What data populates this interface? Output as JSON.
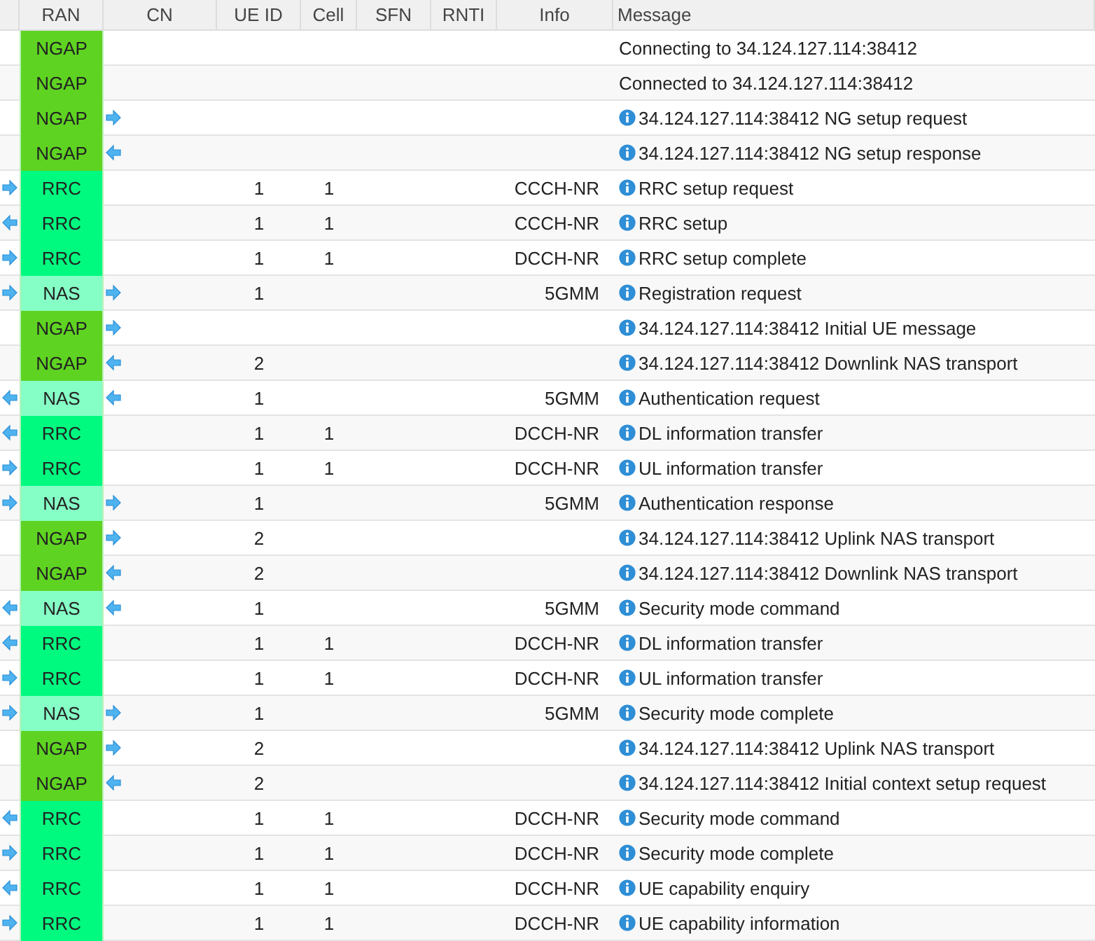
{
  "columns": [
    "",
    "RAN",
    "CN",
    "UE ID",
    "Cell",
    "SFN",
    "RNTI",
    "Info",
    "Message"
  ],
  "rows": [
    {
      "protocol": "NGAP",
      "kind": "ngap",
      "ue_id": "",
      "cell": "",
      "info": "",
      "info_icon": false,
      "message": "Connecting to 34.124.127.114:38412"
    },
    {
      "protocol": "NGAP",
      "kind": "ngap",
      "ue_id": "",
      "cell": "",
      "info": "",
      "info_icon": false,
      "message": "Connected to 34.124.127.114:38412"
    },
    {
      "protocol": "NGAP",
      "kind": "ngap",
      "cn_arrow": {
        "kind": "right"
      },
      "ue_id": "",
      "cell": "",
      "info": "",
      "info_icon": true,
      "message": "34.124.127.114:38412 NG setup request"
    },
    {
      "protocol": "NGAP",
      "kind": "ngap",
      "cn_arrow": {
        "kind": "left"
      },
      "ue_id": "",
      "cell": "",
      "info": "",
      "info_icon": true,
      "message": "34.124.127.114:38412 NG setup response"
    },
    {
      "ran_arrow": {
        "kind": "right"
      },
      "protocol": "RRC",
      "kind": "rrc",
      "ue_id": "1",
      "cell": "1",
      "info": "CCCH-NR",
      "info_icon": true,
      "message": "RRC setup request"
    },
    {
      "ran_arrow": {
        "kind": "left"
      },
      "protocol": "RRC",
      "kind": "rrc",
      "ue_id": "1",
      "cell": "1",
      "info": "CCCH-NR",
      "info_icon": true,
      "message": "RRC setup"
    },
    {
      "ran_arrow": {
        "kind": "right"
      },
      "protocol": "RRC",
      "kind": "rrc",
      "ue_id": "1",
      "cell": "1",
      "info": "DCCH-NR",
      "info_icon": true,
      "message": "RRC setup complete"
    },
    {
      "ran_arrow": {
        "kind": "right"
      },
      "protocol": "NAS",
      "kind": "nas",
      "cn_arrow": {
        "kind": "right"
      },
      "ue_id": "1",
      "cell": "",
      "info": "5GMM",
      "info_icon": true,
      "message": "Registration request"
    },
    {
      "protocol": "NGAP",
      "kind": "ngap",
      "cn_arrow": {
        "kind": "right"
      },
      "ue_id": "",
      "cell": "",
      "info": "",
      "info_icon": true,
      "message": "34.124.127.114:38412 Initial UE message"
    },
    {
      "protocol": "NGAP",
      "kind": "ngap",
      "cn_arrow": {
        "kind": "left"
      },
      "ue_id": "2",
      "cell": "",
      "info": "",
      "info_icon": true,
      "message": "34.124.127.114:38412 Downlink NAS transport"
    },
    {
      "ran_arrow": {
        "kind": "left"
      },
      "protocol": "NAS",
      "kind": "nas",
      "cn_arrow": {
        "kind": "left"
      },
      "ue_id": "1",
      "cell": "",
      "info": "5GMM",
      "info_icon": true,
      "message": "Authentication request"
    },
    {
      "ran_arrow": {
        "kind": "left"
      },
      "protocol": "RRC",
      "kind": "rrc",
      "ue_id": "1",
      "cell": "1",
      "info": "DCCH-NR",
      "info_icon": true,
      "message": "DL information transfer"
    },
    {
      "ran_arrow": {
        "kind": "right"
      },
      "protocol": "RRC",
      "kind": "rrc",
      "ue_id": "1",
      "cell": "1",
      "info": "DCCH-NR",
      "info_icon": true,
      "message": "UL information transfer"
    },
    {
      "ran_arrow": {
        "kind": "right"
      },
      "protocol": "NAS",
      "kind": "nas",
      "cn_arrow": {
        "kind": "right"
      },
      "ue_id": "1",
      "cell": "",
      "info": "5GMM",
      "info_icon": true,
      "message": "Authentication response"
    },
    {
      "protocol": "NGAP",
      "kind": "ngap",
      "cn_arrow": {
        "kind": "right"
      },
      "ue_id": "2",
      "cell": "",
      "info": "",
      "info_icon": true,
      "message": "34.124.127.114:38412 Uplink NAS transport"
    },
    {
      "protocol": "NGAP",
      "kind": "ngap",
      "cn_arrow": {
        "kind": "left"
      },
      "ue_id": "2",
      "cell": "",
      "info": "",
      "info_icon": true,
      "message": "34.124.127.114:38412 Downlink NAS transport"
    },
    {
      "ran_arrow": {
        "kind": "left"
      },
      "protocol": "NAS",
      "kind": "nas",
      "cn_arrow": {
        "kind": "left"
      },
      "ue_id": "1",
      "cell": "",
      "info": "5GMM",
      "info_icon": true,
      "message": "Security mode command"
    },
    {
      "ran_arrow": {
        "kind": "left"
      },
      "protocol": "RRC",
      "kind": "rrc",
      "ue_id": "1",
      "cell": "1",
      "info": "DCCH-NR",
      "info_icon": true,
      "message": "DL information transfer"
    },
    {
      "ran_arrow": {
        "kind": "right"
      },
      "protocol": "RRC",
      "kind": "rrc",
      "ue_id": "1",
      "cell": "1",
      "info": "DCCH-NR",
      "info_icon": true,
      "message": "UL information transfer"
    },
    {
      "ran_arrow": {
        "kind": "right"
      },
      "protocol": "NAS",
      "kind": "nas",
      "cn_arrow": {
        "kind": "right"
      },
      "ue_id": "1",
      "cell": "",
      "info": "5GMM",
      "info_icon": true,
      "message": "Security mode complete"
    },
    {
      "protocol": "NGAP",
      "kind": "ngap",
      "cn_arrow": {
        "kind": "right"
      },
      "ue_id": "2",
      "cell": "",
      "info": "",
      "info_icon": true,
      "message": "34.124.127.114:38412 Uplink NAS transport"
    },
    {
      "protocol": "NGAP",
      "kind": "ngap",
      "cn_arrow": {
        "kind": "left"
      },
      "ue_id": "2",
      "cell": "",
      "info": "",
      "info_icon": true,
      "message": "34.124.127.114:38412 Initial context setup request"
    },
    {
      "ran_arrow": {
        "kind": "left"
      },
      "protocol": "RRC",
      "kind": "rrc",
      "ue_id": "1",
      "cell": "1",
      "info": "DCCH-NR",
      "info_icon": true,
      "message": "Security mode command"
    },
    {
      "ran_arrow": {
        "kind": "right"
      },
      "protocol": "RRC",
      "kind": "rrc",
      "ue_id": "1",
      "cell": "1",
      "info": "DCCH-NR",
      "info_icon": true,
      "message": "Security mode complete"
    },
    {
      "ran_arrow": {
        "kind": "left"
      },
      "protocol": "RRC",
      "kind": "rrc",
      "ue_id": "1",
      "cell": "1",
      "info": "DCCH-NR",
      "info_icon": true,
      "message": "UE capability enquiry"
    },
    {
      "ran_arrow": {
        "kind": "right"
      },
      "protocol": "RRC",
      "kind": "rrc",
      "ue_id": "1",
      "cell": "1",
      "info": "DCCH-NR",
      "info_icon": true,
      "message": "UE capability information"
    }
  ]
}
